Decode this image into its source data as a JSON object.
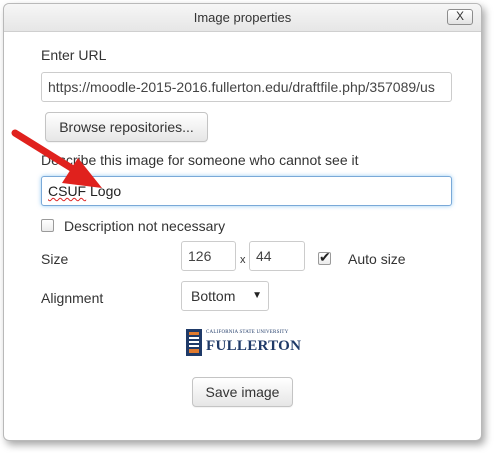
{
  "dialog": {
    "title": "Image properties",
    "close_label": "X"
  },
  "url": {
    "label": "Enter URL",
    "value": "https://moodle-2015-2016.fullerton.edu/draftfile.php/357089/us"
  },
  "browse_button": "Browse repositories...",
  "description": {
    "label": "Describe this image for someone who cannot see it",
    "value_word1": "CSUF",
    "value_rest": " Logo"
  },
  "desc_not_necessary": {
    "label": "Description not necessary",
    "checked": false
  },
  "size": {
    "label": "Size",
    "width": "126",
    "separator": "x",
    "height": "44",
    "auto_size_label": "Auto size",
    "auto_size_checked": true
  },
  "alignment": {
    "label": "Alignment",
    "selected": "Bottom"
  },
  "logo": {
    "top_text": "CALIFORNIA STATE UNIVERSITY",
    "main_text": "FULLERTON"
  },
  "save_button": "Save image",
  "colors": {
    "arrow": "#e0211d",
    "logo_blue": "#1f3a68",
    "logo_orange": "#e07a2e"
  }
}
